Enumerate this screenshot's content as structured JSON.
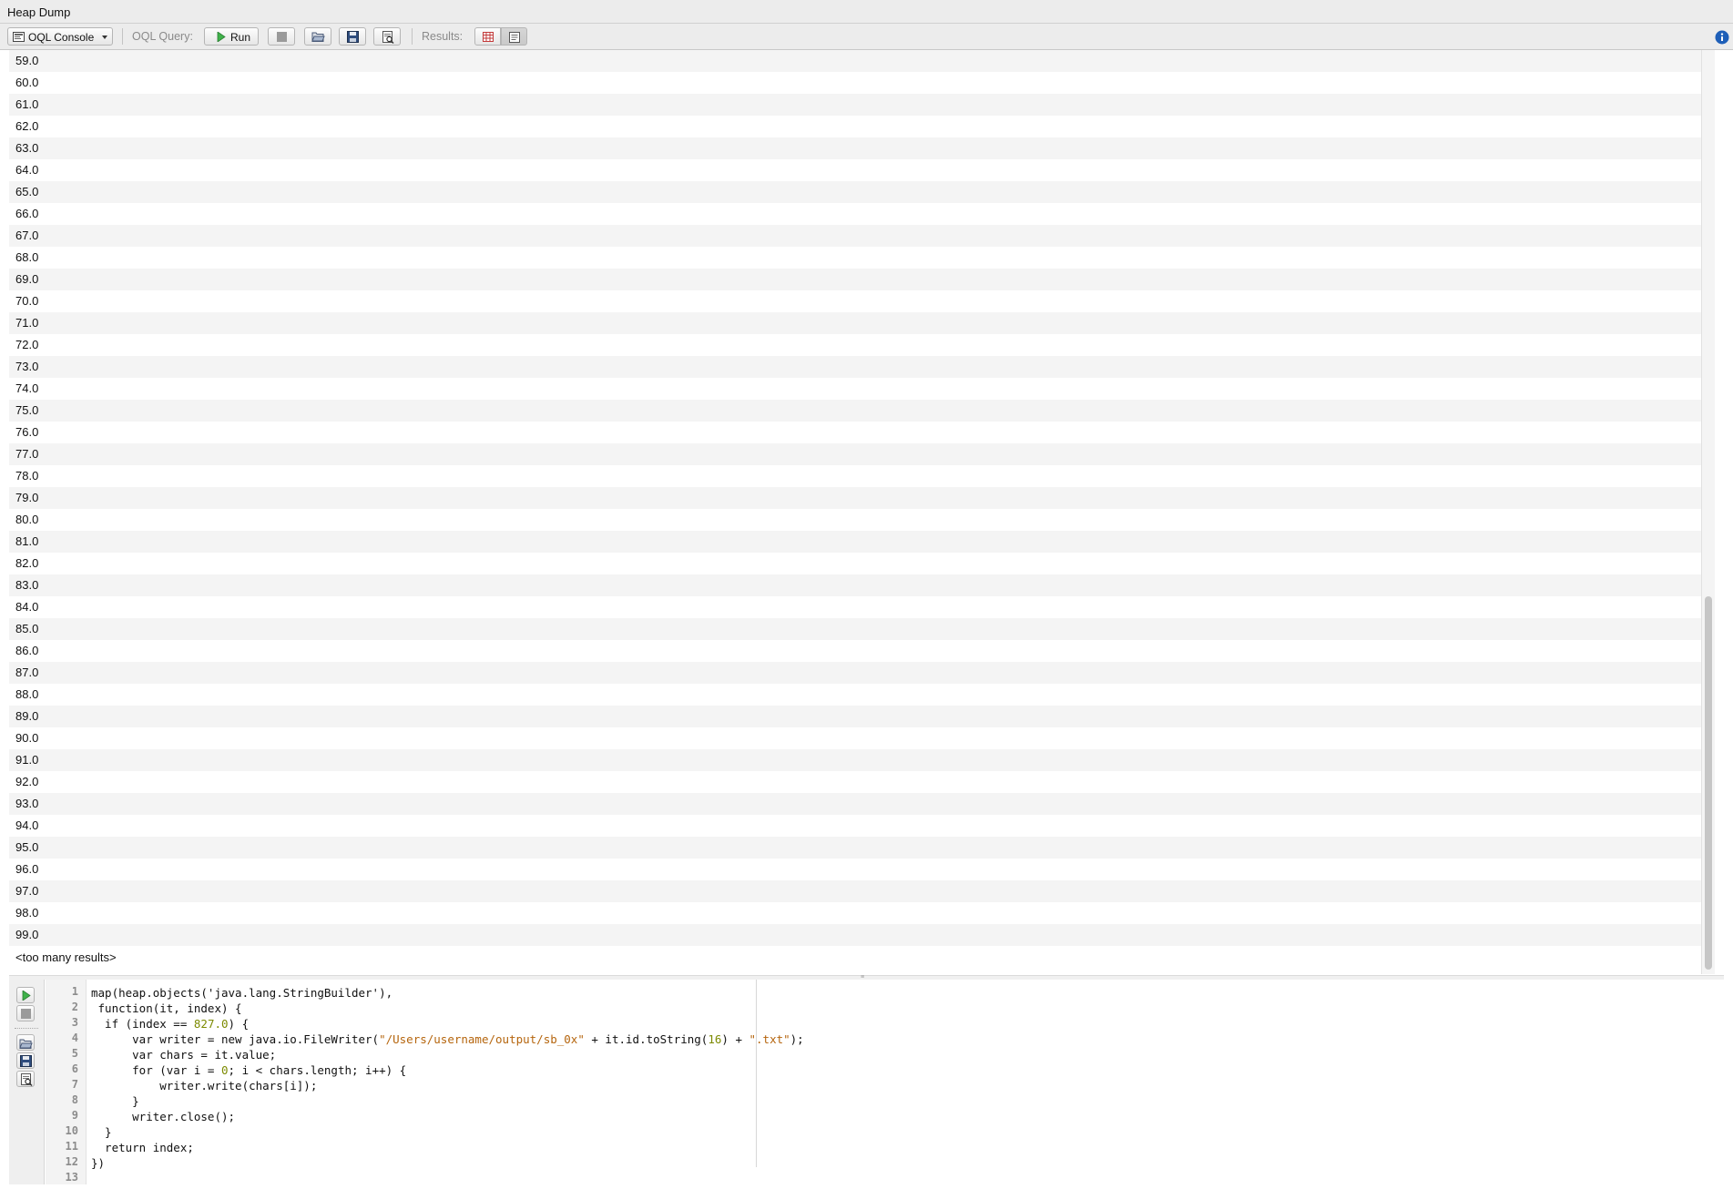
{
  "window": {
    "title": "Heap Dump"
  },
  "toolbar": {
    "console_select": "OQL Console",
    "query_label": "OQL Query:",
    "run_label": "Run",
    "results_label": "Results:",
    "icons": [
      "console-icon",
      "play-icon",
      "stop-icon",
      "open-folder-icon",
      "save-icon",
      "save-as-icon",
      "table-view-icon",
      "html-view-icon",
      "info-icon"
    ]
  },
  "results": {
    "rows": [
      "59.0",
      "60.0",
      "61.0",
      "62.0",
      "63.0",
      "64.0",
      "65.0",
      "66.0",
      "67.0",
      "68.0",
      "69.0",
      "70.0",
      "71.0",
      "72.0",
      "73.0",
      "74.0",
      "75.0",
      "76.0",
      "77.0",
      "78.0",
      "79.0",
      "80.0",
      "81.0",
      "82.0",
      "83.0",
      "84.0",
      "85.0",
      "86.0",
      "87.0",
      "88.0",
      "89.0",
      "90.0",
      "91.0",
      "92.0",
      "93.0",
      "94.0",
      "95.0",
      "96.0",
      "97.0",
      "98.0",
      "99.0"
    ],
    "overflow_text": "<too many results>"
  },
  "editor": {
    "line_numbers": [
      "1",
      "2",
      "3",
      "4",
      "5",
      "6",
      "7",
      "8",
      "9",
      "10",
      "11",
      "12",
      "13"
    ],
    "lines": [
      "map(heap.objects('java.lang.StringBuilder'),",
      " function(it, index) {",
      "  if (index == 827.0) {",
      "      var writer = new java.io.FileWriter(\"/Users/username/output/sb_0x\" + it.id.toString(16) + \".txt\");",
      "      var chars = it.value;",
      "      for (var i = 0; i < chars.length; i++) {",
      "          writer.write(chars[i]);",
      "      }",
      "      writer.close();",
      "  }",
      "  return index;",
      "})",
      ""
    ]
  }
}
